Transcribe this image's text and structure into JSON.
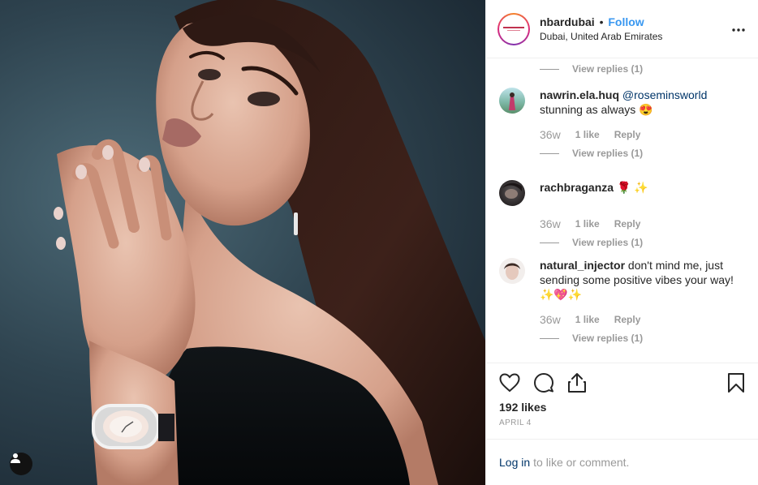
{
  "header": {
    "username": "nbardubai",
    "separator": "•",
    "follow_label": "Follow",
    "location": "Dubai, United Arab Emirates",
    "more_icon": "more-horizontal-icon"
  },
  "comments": [
    {
      "partial": true,
      "view_replies": "View replies (1)"
    },
    {
      "username": "nawrin.ela.huq",
      "mention": "@roseminsworld",
      "text": "stunning as always 😍",
      "time": "36w",
      "likes": "1 like",
      "reply_label": "Reply",
      "view_replies": "View replies (1)"
    },
    {
      "username": "rachbraganza",
      "text": "🌹 ✨",
      "time": "36w",
      "likes": "1 like",
      "reply_label": "Reply",
      "view_replies": "View replies (1)"
    },
    {
      "username": "natural_injector",
      "text": "don't mind me, just sending some positive vibes your way! ✨💖✨",
      "time": "36w",
      "likes": "1 like",
      "reply_label": "Reply",
      "view_replies": "View replies (1)"
    }
  ],
  "actions": {
    "like_icon": "heart-icon",
    "comment_icon": "comment-bubble-icon",
    "share_icon": "share-icon",
    "save_icon": "bookmark-icon",
    "likes_count": "192 likes",
    "date": "APRIL 4"
  },
  "login_bar": {
    "login_label": "Log in",
    "suffix": "to like or comment."
  },
  "colors": {
    "link_blue": "#3897f0",
    "dark_link": "#003569",
    "muted": "#999999",
    "text": "#262626",
    "border": "#efefef"
  }
}
